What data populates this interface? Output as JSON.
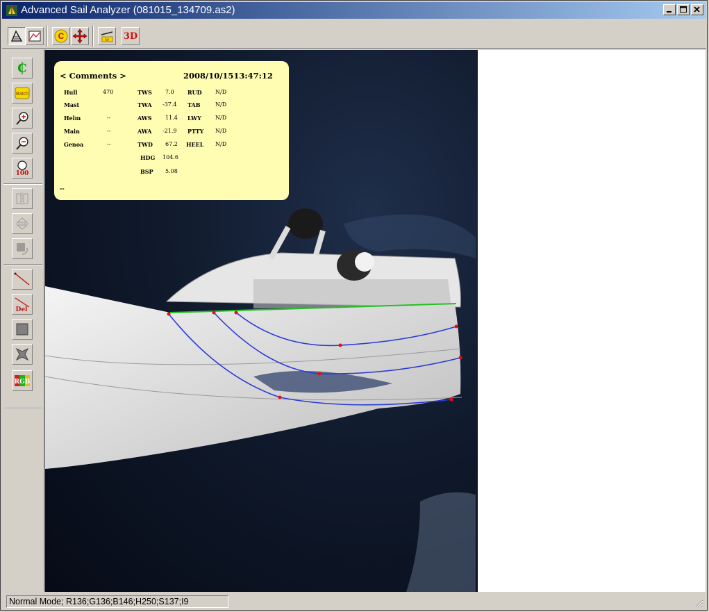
{
  "window": {
    "title": "Advanced Sail Analyzer (081015_134709.as2)"
  },
  "toolbar": {
    "draw_label": "",
    "threed_label": "3D"
  },
  "left_tools": {
    "batch_label": "Batch",
    "zoom100_label": "100",
    "delete_label": "Del",
    "rgb_label": "RGB"
  },
  "comments": {
    "header": "< Comments >",
    "datetime": "2008/10/1513:47:12",
    "col1": [
      {
        "label": "Hull",
        "value": "470"
      },
      {
        "label": "Mast",
        "value": ""
      },
      {
        "label": "Helm",
        "value": "--"
      },
      {
        "label": "Main",
        "value": "--"
      },
      {
        "label": "Genoa",
        "value": "--"
      }
    ],
    "col2": [
      {
        "label": "TWS",
        "value": "7.0"
      },
      {
        "label": "TWA",
        "value": "-37.4"
      },
      {
        "label": "AWS",
        "value": "11.4"
      },
      {
        "label": "AWA",
        "value": "-21.9"
      },
      {
        "label": "TWD",
        "value": "67.2"
      },
      {
        "label": "HDG",
        "value": "104.6"
      },
      {
        "label": "BSP",
        "value": "5.08"
      }
    ],
    "col3": [
      {
        "label": "RUD",
        "value": "N/D"
      },
      {
        "label": "TAB",
        "value": "N/D"
      },
      {
        "label": "LWY",
        "value": "N/D"
      },
      {
        "label": "PTTY",
        "value": "N/D"
      },
      {
        "label": "HEEL",
        "value": "N/D"
      }
    ],
    "footer": "--"
  },
  "status": {
    "text": "Normal Mode; R136;G136;B146;H250;S137;I9"
  },
  "colors": {
    "title_start": "#0a246a",
    "title_end": "#a6caf0",
    "comment_bg": "#fffdb2",
    "sail_curve": "#2b3bd6",
    "sail_point": "#e01010",
    "luff_line": "#22c020"
  }
}
